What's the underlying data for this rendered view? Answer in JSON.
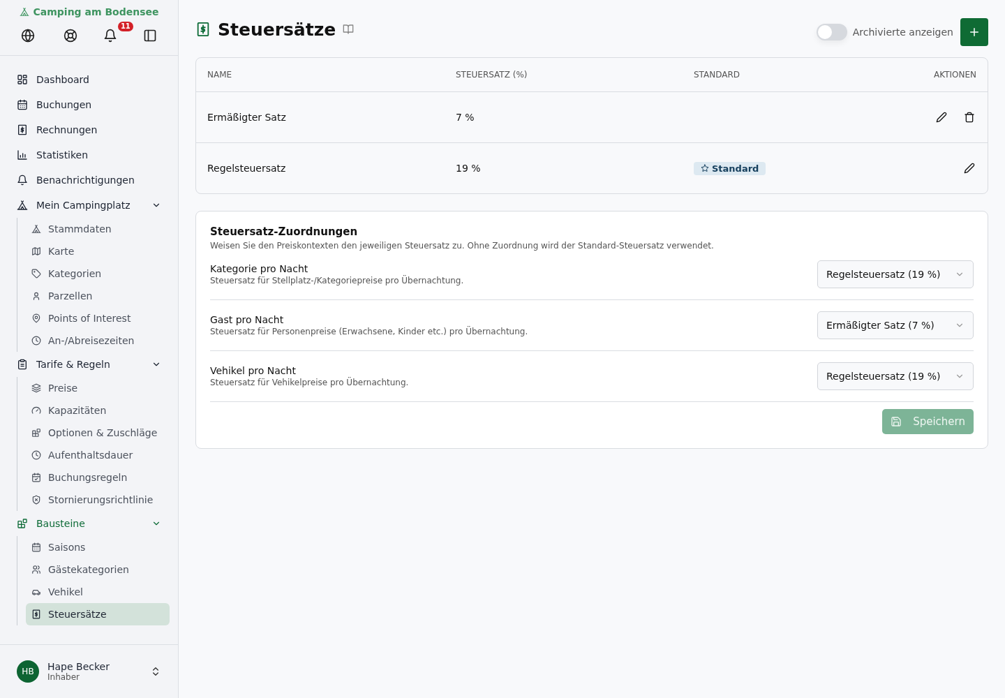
{
  "sidebar": {
    "brand": "Camping am Bodensee",
    "notification_count": "11",
    "items": [
      {
        "label": "Dashboard",
        "selected": false
      },
      {
        "label": "Buchungen",
        "selected": false
      },
      {
        "label": "Rechnungen",
        "selected": false
      },
      {
        "label": "Statistiken",
        "selected": false
      },
      {
        "label": "Benachrichtigungen",
        "selected": false
      },
      {
        "label": "Mein Campingplatz",
        "selected": false,
        "expanded": true,
        "children": [
          {
            "label": "Stammdaten",
            "selected": false
          },
          {
            "label": "Karte",
            "selected": false
          },
          {
            "label": "Kategorien",
            "selected": false
          },
          {
            "label": "Parzellen",
            "selected": false
          },
          {
            "label": "Points of Interest",
            "selected": false
          },
          {
            "label": "An-/Abreisezeiten",
            "selected": false
          }
        ]
      },
      {
        "label": "Tarife & Regeln",
        "selected": false,
        "expanded": true,
        "children": [
          {
            "label": "Preise",
            "selected": false
          },
          {
            "label": "Kapazitäten",
            "selected": false
          },
          {
            "label": "Optionen & Zuschläge",
            "selected": false
          },
          {
            "label": "Aufenthaltsdauer",
            "selected": false
          },
          {
            "label": "Buchungsregeln",
            "selected": false
          },
          {
            "label": "Stornierungsrichtlinie",
            "selected": false
          }
        ]
      },
      {
        "label": "Bausteine",
        "selected": false,
        "expanded": true,
        "children": [
          {
            "label": "Saisons",
            "selected": false
          },
          {
            "label": "Gästekategorien",
            "selected": false
          },
          {
            "label": "Vehikel",
            "selected": false
          },
          {
            "label": "Steuersätze",
            "selected": true
          }
        ]
      }
    ],
    "user": {
      "initials": "HB",
      "name": "Hape Becker",
      "role": "Inhaber"
    }
  },
  "header": {
    "title": "Steuersätze",
    "archive_toggle": {
      "label": "Archivierte anzeigen",
      "on": false
    }
  },
  "table": {
    "columns": [
      "NAME",
      "STEUERSATZ (%)",
      "STANDARD",
      "AKTIONEN"
    ],
    "rows": [
      {
        "name": "Ermäßigter Satz",
        "rate": "7 %",
        "deletable": true
      },
      {
        "name": "Regelsteuersatz",
        "rate": "19 %",
        "badge": "Standard",
        "deletable": false
      }
    ]
  },
  "mappings": {
    "title": "Steuersatz-Zuordnungen",
    "description": "Weisen Sie den Preiskontexten den jeweiligen Steuersatz zu. Ohne Zuordnung wird der Standard-Steuersatz verwendet.",
    "rows": [
      {
        "label": "Kategorie pro Nacht",
        "hint": "Steuersatz für Stellplatz-/Kategoriepreise pro Übernachtung.",
        "value": "Regelsteuersatz (19 %)"
      },
      {
        "label": "Gast pro Nacht",
        "hint": "Steuersatz für Personenpreise (Erwachsene, Kinder etc.) pro Übernachtung.",
        "value": "Ermäßigter Satz (7 %)"
      },
      {
        "label": "Vehikel pro Nacht",
        "hint": "Steuersatz für Vehikelpreise pro Übernachtung.",
        "value": "Regelsteuersatz (19 %)"
      }
    ],
    "save": {
      "label": "Speichern",
      "disabled": true
    }
  }
}
